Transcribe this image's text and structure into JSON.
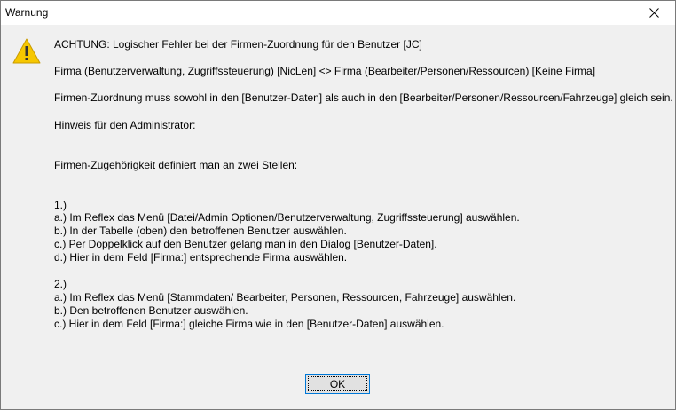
{
  "window": {
    "title": "Warnung"
  },
  "icon": "warning-icon",
  "message": {
    "headline": "ACHTUNG: Logischer Fehler bei der Firmen-Zuordnung für den Benutzer [JC]",
    "detail": "Firma (Benutzerverwaltung, Zugriffssteuerung) [NicLen] <> Firma (Bearbeiter/Personen/Ressourcen) [Keine Firma]",
    "requirement": "Firmen-Zuordnung muss sowohl in den [Benutzer-Daten] als auch in den [Bearbeiter/Personen/Ressourcen/Fahrzeuge] gleich sein.",
    "admin_hint": "Hinweis für den Administrator:",
    "intro": "Firmen-Zugehörigkeit definiert man an zwei Stellen:",
    "section1": {
      "number": "1.)",
      "steps": [
        "a.) Im Reflex das Menü [Datei/Admin Optionen/Benutzerverwaltung, Zugriffssteuerung] auswählen.",
        "b.) In der Tabelle (oben) den betroffenen Benutzer auswählen.",
        "c.) Per Doppelklick auf den Benutzer gelang man in den Dialog [Benutzer-Daten].",
        "d.) Hier in dem Feld [Firma:] entsprechende Firma auswählen."
      ]
    },
    "section2": {
      "number": "2.)",
      "steps": [
        "a.) Im Reflex das Menü [Stammdaten/ Bearbeiter, Personen, Ressourcen, Fahrzeuge] auswählen.",
        "b.) Den betroffenen Benutzer auswählen.",
        "c.) Hier in dem Feld [Firma:] gleiche Firma wie in den [Benutzer-Daten] auswählen."
      ]
    }
  },
  "buttons": {
    "ok_label": "OK"
  },
  "colors": {
    "dialog_background": "#f0f0f0",
    "titlebar_background": "#ffffff",
    "button_focus_border": "#0078d7",
    "warning_yellow": "#f6c700"
  }
}
